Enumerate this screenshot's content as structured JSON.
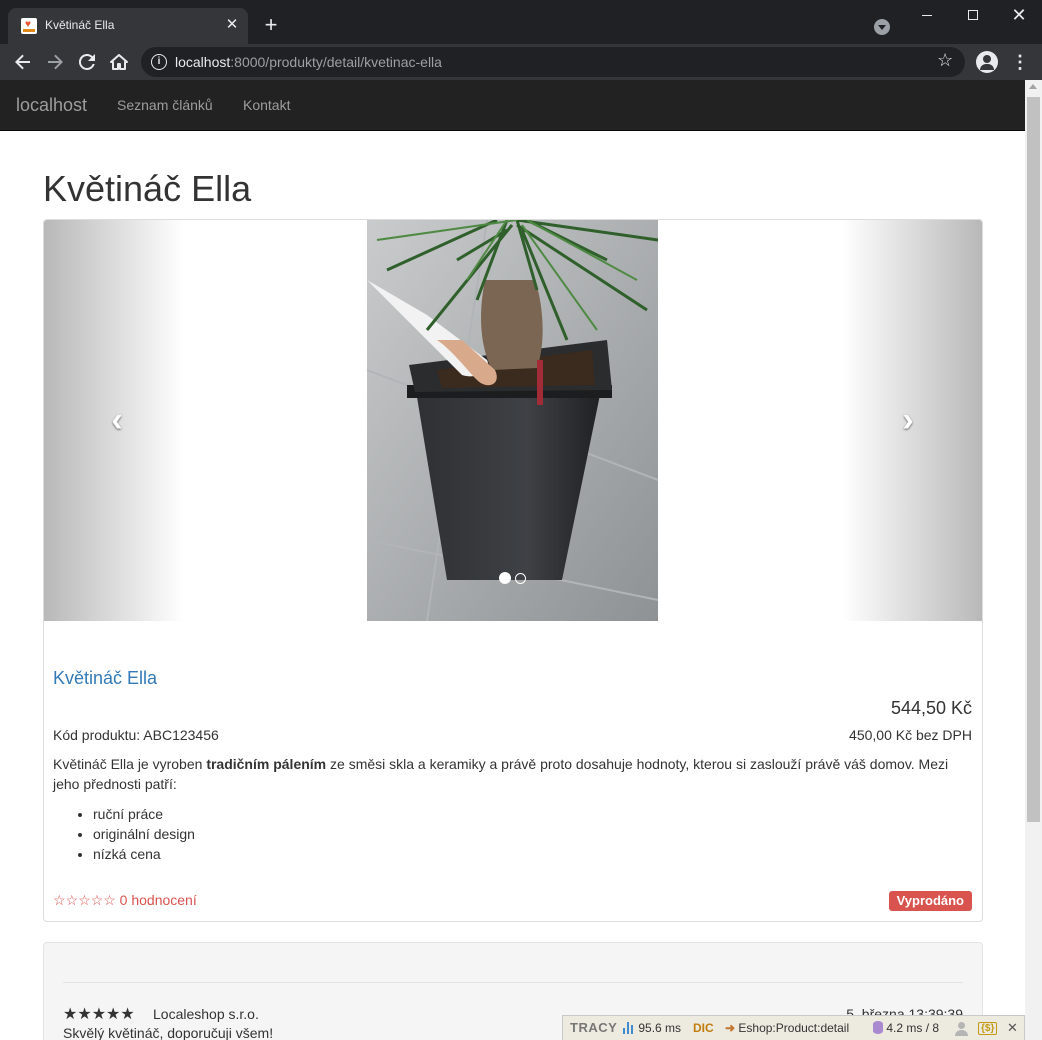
{
  "browser": {
    "tab_title": "Květináč Ella",
    "tab_close": "✕",
    "new_tab": "+",
    "url_host": "localhost",
    "url_rest": ":8000/produkty/detail/kvetinac-ella",
    "icons": [
      "favicon",
      "close-icon",
      "plus-icon",
      "tab-search-icon",
      "back-icon",
      "forward-icon",
      "reload-icon",
      "home-icon",
      "info-icon",
      "star-icon",
      "profile-icon",
      "menu-icon"
    ]
  },
  "navbar": {
    "brand": "localhost",
    "links": [
      "Seznam článků",
      "Kontakt"
    ]
  },
  "page": {
    "title": "Květináč Ella"
  },
  "carousel": {
    "prev": "‹",
    "next": "›",
    "slides_count": 2,
    "active_slide": 1
  },
  "product": {
    "name": "Květináč Ella",
    "price": "544,50 Kč",
    "code_label": "Kód produktu: ABC123456",
    "price_net": "450,00 Kč bez DPH",
    "desc_before": "Květináč Ella je vyroben ",
    "desc_bold": "tradičním pálením",
    "desc_after": " ze směsi skla a keramiky a právě proto dosahuje hodnoty, kterou si zaslouží právě váš domov. Mezi jeho přednosti patří:",
    "features": [
      "ruční práce",
      "originální design",
      "nízká cena"
    ],
    "rating_stars": "☆☆☆☆☆",
    "rating_text": " 0 hodnocení",
    "status_badge": "Vyprodáno",
    "colors": {
      "link": "#337ab7",
      "danger": "#d9534f"
    }
  },
  "review": {
    "stars": "★★★★★",
    "author": "Localeshop s.r.o.",
    "date": "5. března 13:39:39",
    "text": "Skvělý květináč, doporučuji všem!"
  },
  "tracy": {
    "logo": "TRACY",
    "time": "95.6 ms",
    "dic": "DIC",
    "route": "Eshop:Product:detail",
    "db": "4.2 ms / 8",
    "session": "{$}",
    "close": "✕"
  }
}
